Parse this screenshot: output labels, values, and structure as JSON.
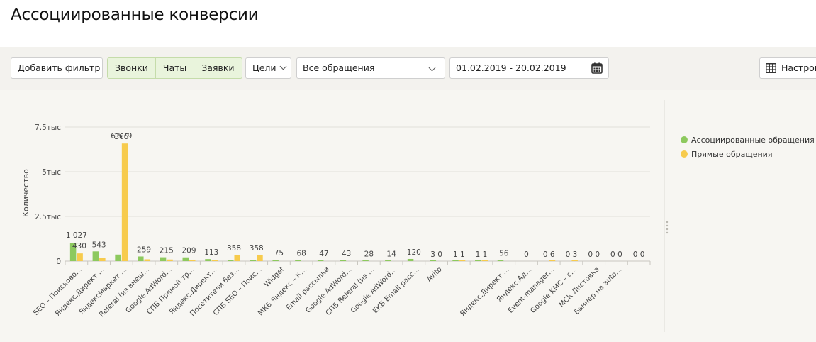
{
  "page": {
    "title": "Ассоциированные конверсии"
  },
  "toolbar": {
    "add_filter": "Добавить фильтр",
    "segments": [
      "Звонки",
      "Чаты",
      "Заявки"
    ],
    "goals": "Цели",
    "requests_select": "Все обращения",
    "date_range": "01.02.2019 - 20.02.2019",
    "settings": "Настройки"
  },
  "colors": {
    "associated": "#8dc95e",
    "direct": "#f7cb4d",
    "accent_segment": "#e9f4dc"
  },
  "chart_data": {
    "type": "bar",
    "ylabel": "Количество",
    "ylim": [
      0,
      7500
    ],
    "yticks": [
      0,
      2500,
      5000,
      7500
    ],
    "ytick_labels": [
      "0",
      "2.5тыс",
      "5тыс",
      "7.5тыс"
    ],
    "grid": true,
    "legend_position": "right",
    "categories": [
      "SEO – Поисково…",
      "Яндекс.Директ …",
      "ЯндексМаркет …",
      "Referal (из внеш…",
      "Google AdWord…",
      "СПБ Прямой тр…",
      "Яндекс.Директ…",
      "Посетители без…",
      "СПБ SEO – Поис…",
      "Widget",
      "МКБ Яндекс – К…",
      "Email рассылки",
      "Google AdWord…",
      "СПБ Referal (из …",
      "Google AdWord…",
      "ЕКБ Email расс…",
      "Avito",
      "",
      "",
      "Яндекс.Директ …",
      "Яндекс.Ад…",
      "Event-manager…",
      "Google KMC – с…",
      "МСК Листовка",
      "Баннер на auto…",
      ""
    ],
    "series": [
      {
        "name": "Ассоциированные обращения",
        "values": [
          1027,
          543,
          366,
          259,
          215,
          209,
          113,
          75,
          75,
          75,
          68,
          47,
          43,
          28,
          14,
          120,
          3,
          1,
          1,
          56,
          0,
          0,
          0,
          0,
          0,
          0
        ]
      },
      {
        "name": "Прямые обращения",
        "values": [
          430,
          170,
          6579,
          100,
          90,
          80,
          20,
          358,
          358,
          0,
          0,
          0,
          0,
          0,
          0,
          0,
          0,
          1,
          1,
          0,
          0,
          6,
          3,
          0,
          0,
          0
        ]
      }
    ],
    "bar_labels": [
      "1 027\n430",
      "543",
      "366",
      "259",
      "215",
      "209",
      "113",
      "358",
      "358",
      "75",
      "68",
      "47",
      "43",
      "28",
      "14",
      "120",
      "3 0",
      "1 1",
      "1 1",
      "56",
      "0",
      "0 6",
      "0 3",
      "0 0",
      "0 0",
      "0 0"
    ],
    "top_label": "6 579"
  }
}
